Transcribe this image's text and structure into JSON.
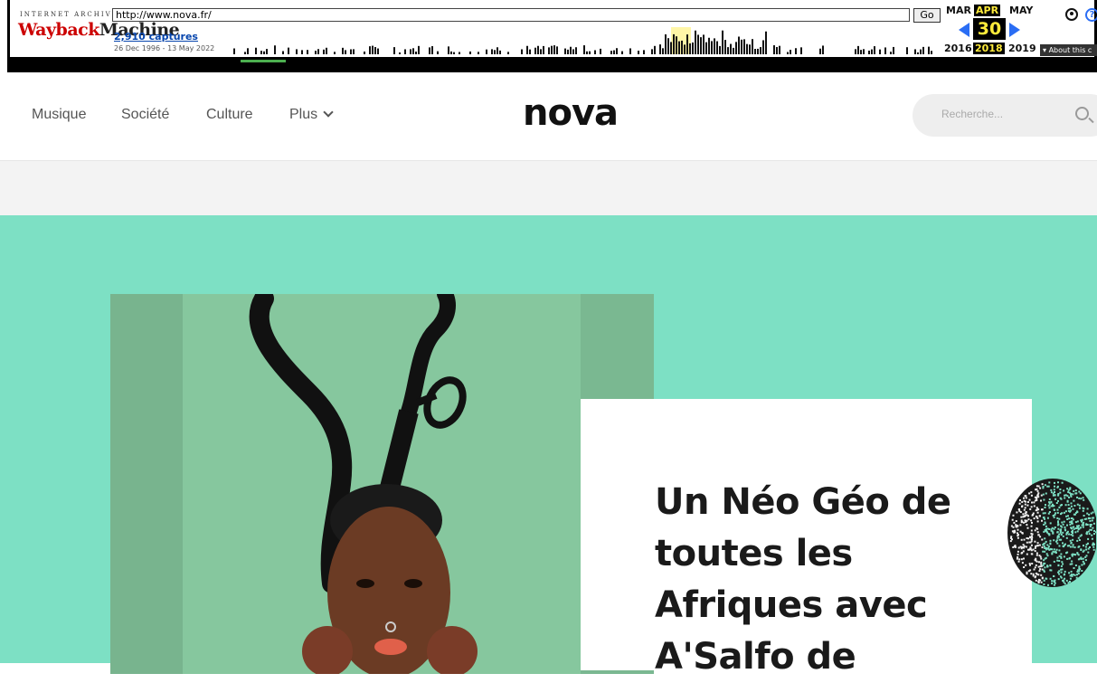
{
  "wayback": {
    "ia_label": "INTERNET ARCHIVE",
    "logo_red": "Wayback",
    "logo_dark": "Machine",
    "url": "http://www.nova.fr/",
    "go_label": "Go",
    "captures": "2,910 captures",
    "date_range": "26 Dec 1996 - 13 May 2022",
    "months": {
      "prev": "MAR",
      "current": "APR",
      "next": "MAY"
    },
    "day": "30",
    "years": {
      "prev": "2016",
      "current": "2018",
      "next": "2019"
    },
    "about": "About this c",
    "help_glyph": "?"
  },
  "nav": {
    "items": [
      "Musique",
      "Société",
      "Culture"
    ],
    "more": "Plus"
  },
  "logo": "nova",
  "search": {
    "placeholder": "Recherche..."
  },
  "hero": {
    "title": "Un Néo Géo de toutes les Afriques avec A'Salfo de",
    "bg_color": "#7de0c4"
  }
}
